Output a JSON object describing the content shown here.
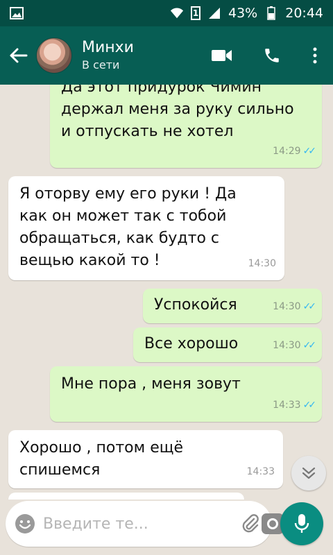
{
  "status_bar": {
    "sim": "1",
    "battery": "43%",
    "time": "20:44"
  },
  "header": {
    "name": "Минхи",
    "status": "В сети"
  },
  "messages": [
    {
      "direction": "out",
      "lines": [
        "Да этот придурок Чимин",
        "держал меня за руку сильно",
        "и отпускать не хотел"
      ],
      "time": "14:29",
      "read": true
    },
    {
      "direction": "in",
      "lines": [
        "Я оторву ему его руки ! Да",
        "как он может так с тобой",
        "обращаться, как будто с",
        "вещью какой то !"
      ],
      "time": "14:30"
    },
    {
      "direction": "out",
      "lines": [
        "Успокойся"
      ],
      "time": "14:30",
      "read": true
    },
    {
      "direction": "out",
      "lines": [
        "Все хорошо"
      ],
      "time": "14:30",
      "read": true
    },
    {
      "direction": "out",
      "lines": [
        "Мне пора , меня зовут"
      ],
      "time": "14:33",
      "read": true
    },
    {
      "direction": "in",
      "lines": [
        "Хорошо , потом ещё",
        "спишемся"
      ],
      "time": "14:33"
    }
  ],
  "composer": {
    "placeholder": "Введите те..."
  },
  "colors": {
    "header": "#075e54",
    "status_bar": "#054d44",
    "outgoing_bubble": "#dcf8c6",
    "incoming_bubble": "#ffffff",
    "read_ticks": "#34b7f1",
    "mic_button": "#0a8d81"
  },
  "icons": {
    "status_left": "gallery-icon",
    "status_right": [
      "wifi-icon",
      "sim-icon",
      "signal-icon",
      "battery-icon"
    ],
    "header": [
      "back-arrow-icon",
      "video-call-icon",
      "phone-icon",
      "more-vert-icon"
    ],
    "composer": [
      "emoji-icon",
      "attach-icon",
      "camera-icon",
      "mic-icon"
    ],
    "scroll": "chevron-double-down-icon"
  }
}
